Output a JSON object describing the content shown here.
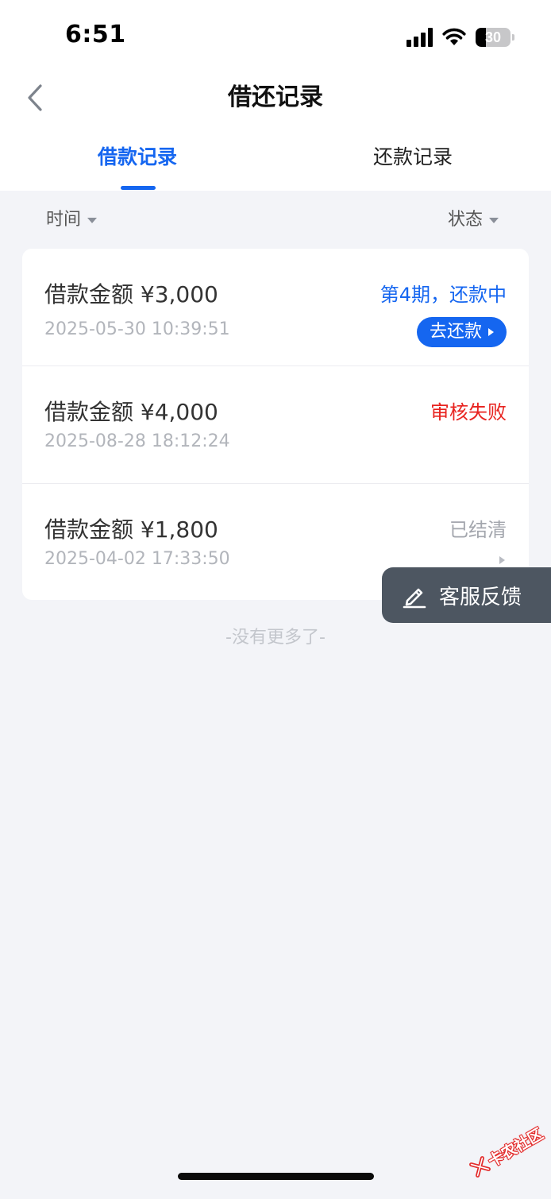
{
  "status_bar": {
    "time": "6:51",
    "battery": "30",
    "battery_level": 0.3
  },
  "header": {
    "title": "借还记录"
  },
  "tabs": [
    {
      "label": "借款记录",
      "active": true
    },
    {
      "label": "还款记录",
      "active": false
    }
  ],
  "filters": {
    "time_label": "时间",
    "status_label": "状态"
  },
  "records": [
    {
      "amount": "借款金额 ¥3,000",
      "time": "2025-05-30 10:39:51",
      "status": "第4期，还款中",
      "status_color": "#1566f0",
      "action_label": "去还款"
    },
    {
      "amount": "借款金额 ¥4,000",
      "time": "2025-08-28 18:12:24",
      "status": "审核失败",
      "status_color": "#e8231f"
    },
    {
      "amount": "借款金额 ¥1,800",
      "time": "2025-04-02 17:33:50",
      "status": "已结清",
      "status_color": "#a3a6ad"
    }
  ],
  "footer": {
    "no_more": "-没有更多了-"
  },
  "feedback": {
    "label": "客服反馈"
  },
  "watermark": {
    "text": "卡农社区"
  },
  "colors": {
    "accent": "#1566f0",
    "error": "#e8231f",
    "background": "#f3f4f8"
  }
}
